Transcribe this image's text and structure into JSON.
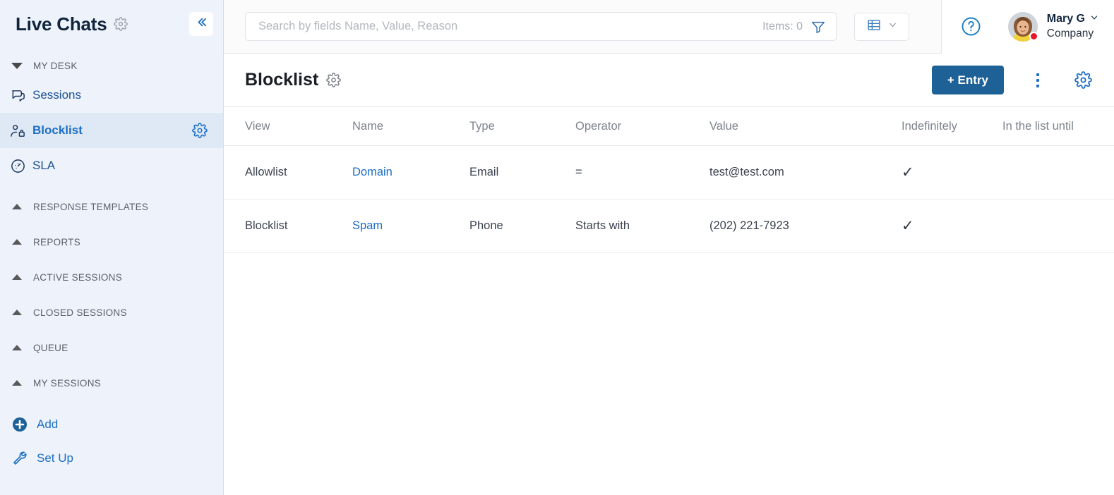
{
  "sidebar": {
    "app_title": "Live Chats",
    "title_gear_icon": "gear-icon",
    "collapse_icon": "chevron-double-left-icon",
    "group": {
      "label": "MY DESK",
      "expanded": true
    },
    "nav_items": [
      {
        "label": "Sessions",
        "icon": "chat-bubbles-icon",
        "active": false
      },
      {
        "label": "Blocklist",
        "icon": "user-lock-icon",
        "active": true,
        "row_gear_icon": "gear-icon"
      },
      {
        "label": "SLA",
        "icon": "speedometer-icon",
        "active": false
      }
    ],
    "groups": [
      {
        "label": "RESPONSE TEMPLATES",
        "expanded": false
      },
      {
        "label": "REPORTS",
        "expanded": false
      },
      {
        "label": "ACTIVE SESSIONS",
        "expanded": false
      },
      {
        "label": "CLOSED SESSIONS",
        "expanded": false
      },
      {
        "label": "QUEUE",
        "expanded": false
      },
      {
        "label": "MY SESSIONS",
        "expanded": false
      }
    ],
    "utilities": [
      {
        "label": "Add",
        "icon": "plus-circle-icon"
      },
      {
        "label": "Set Up",
        "icon": "wrench-icon"
      }
    ]
  },
  "topbar": {
    "search": {
      "value": "",
      "placeholder": "Search by fields Name, Value, Reason"
    },
    "items_count": "Items: 0",
    "filter_icon": "funnel-icon",
    "view_select": {
      "icon": "table-grid-icon",
      "chevron": "chevron-down-icon"
    },
    "help_icon": "question-circle-icon",
    "user": {
      "name": "Mary G",
      "company": "Company",
      "chevron": "chevron-down-icon",
      "avatar_icon": "avatar",
      "status_color": "#e8142d"
    }
  },
  "page": {
    "title": "Blocklist",
    "title_gear_icon": "gear-icon",
    "add_entry_label": "+ Entry",
    "kebab_icon": "more-vertical-icon",
    "settings_icon": "gear-icon"
  },
  "table": {
    "columns": [
      "View",
      "Name",
      "Type",
      "Operator",
      "Value",
      "Indefinitely",
      "In the list until"
    ],
    "rows": [
      {
        "view": "Allowlist",
        "name": "Domain",
        "type": "Email",
        "operator": "=",
        "value": "test@test.com",
        "indefinitely": "✓",
        "in_the_list_until": ""
      },
      {
        "view": "Blocklist",
        "name": "Spam",
        "type": "Phone",
        "operator": "Starts with",
        "value": "(202) 221-7923",
        "indefinitely": "✓",
        "in_the_list_until": ""
      }
    ]
  },
  "colors": {
    "accent_blue": "#1d6ec4",
    "button_blue": "#1d6196",
    "sidebar_bg": "#eef3fb",
    "active_bg": "#dfe9f5",
    "status_red": "#e8142d"
  }
}
